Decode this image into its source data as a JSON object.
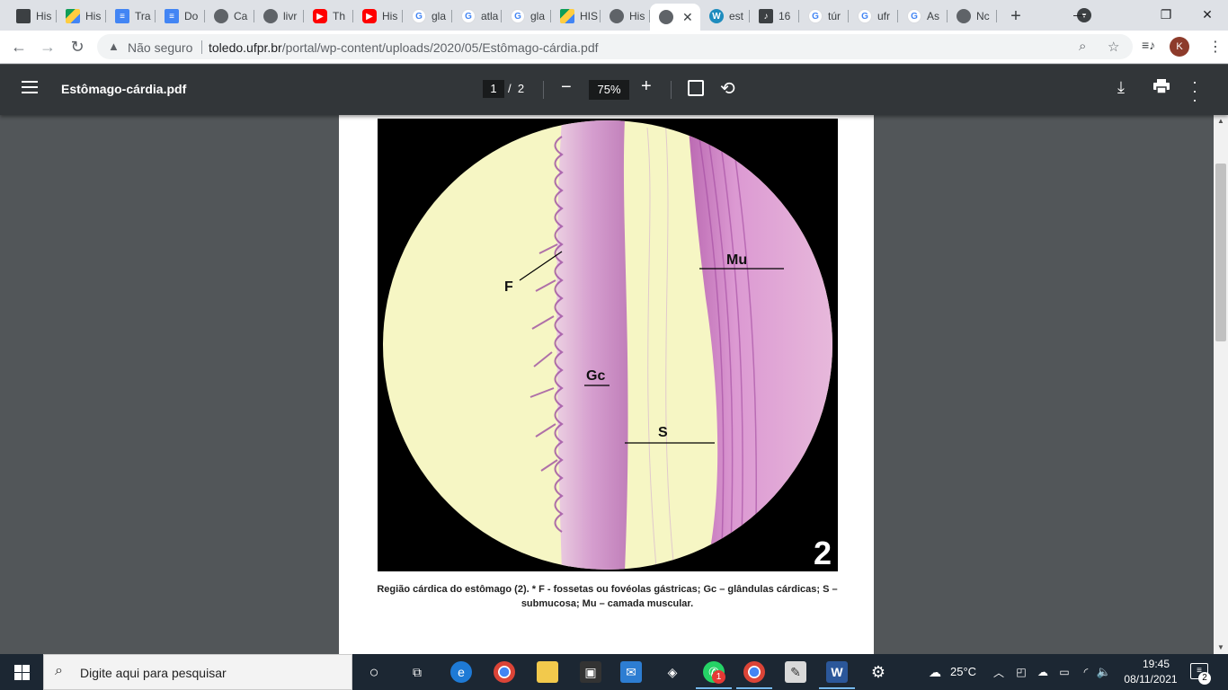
{
  "browser": {
    "tabs": [
      {
        "label": "His",
        "icon": "bookmark-icon"
      },
      {
        "label": "His",
        "icon": "drive-icon"
      },
      {
        "label": "Tra",
        "icon": "docs-icon"
      },
      {
        "label": "Do",
        "icon": "docs-icon"
      },
      {
        "label": "Ca",
        "icon": "globe-icon"
      },
      {
        "label": "livr",
        "icon": "globe-icon"
      },
      {
        "label": "Th",
        "icon": "youtube-icon"
      },
      {
        "label": "His",
        "icon": "youtube-icon"
      },
      {
        "label": "gla",
        "icon": "google-icon"
      },
      {
        "label": "atla",
        "icon": "google-icon"
      },
      {
        "label": "gla",
        "icon": "google-icon"
      },
      {
        "label": "HIS",
        "icon": "drive-icon"
      },
      {
        "label": "His",
        "icon": "globe-icon"
      },
      {
        "label": "",
        "icon": "globe-icon",
        "active": true
      },
      {
        "label": "est",
        "icon": "wordpress-icon"
      },
      {
        "label": "16",
        "icon": "tiktok-icon"
      },
      {
        "label": "túr",
        "icon": "google-icon"
      },
      {
        "label": "ufr",
        "icon": "google-icon"
      },
      {
        "label": "As",
        "icon": "google-icon"
      },
      {
        "label": "Nc",
        "icon": "chrome-icon"
      }
    ],
    "security_label": "Não seguro",
    "url_host": "toledo.ufpr.br",
    "url_path": "/portal/wp-content/uploads/2020/05/Estômago-cárdia.pdf",
    "profile_initial": "K"
  },
  "pdf": {
    "filename": "Estômago-cárdia.pdf",
    "current_page": "1",
    "page_separator": "/",
    "total_pages": "2",
    "zoom": "75%"
  },
  "figure": {
    "labels": {
      "F": "F",
      "Gc": "Gc",
      "S": "S",
      "Mu": "Mu",
      "number": "2"
    },
    "caption": "Região cárdica do estômago (2). * F - fossetas ou fovéolas gástricas; Gc – glândulas cárdicas; S – submucosa; Mu – camada muscular."
  },
  "taskbar": {
    "search_placeholder": "Digite aqui para pesquisar",
    "weather": "25°C",
    "time": "19:45",
    "date": "08/11/2021",
    "notifications": "2",
    "whatsapp_badge": "1"
  },
  "colors": {
    "pdf_toolbar": "#323639",
    "viewer_bg": "#525659",
    "taskbar": "#1c2733",
    "tissue_bg": "#f6f6c4",
    "tissue_pink": "#c77bc0"
  }
}
